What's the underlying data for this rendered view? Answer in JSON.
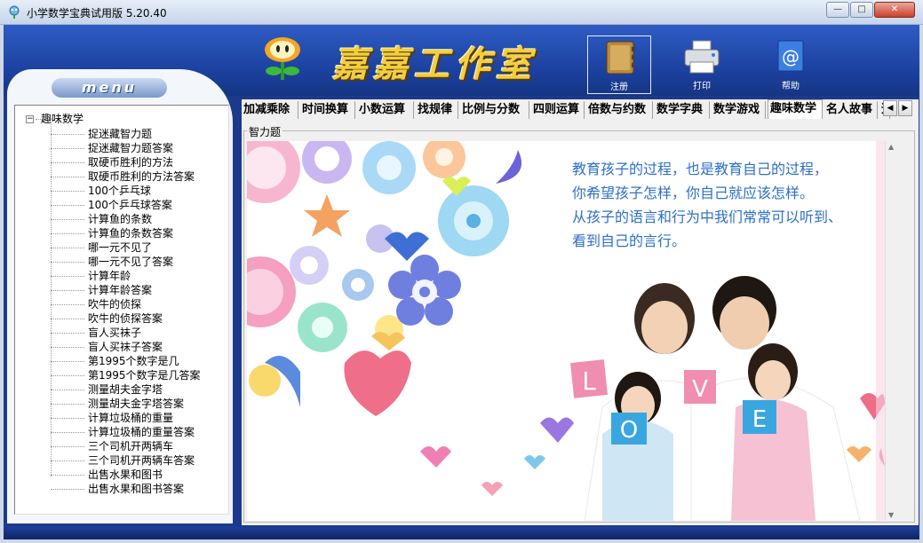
{
  "window": {
    "title": "小学数学宝典试用版  5.20.40",
    "min_glyph": "—",
    "max_glyph": "□",
    "close_glyph": "✕"
  },
  "banner": {
    "brand": "嘉嘉工作室",
    "tools": [
      {
        "label": "注册",
        "icon": "address-book-icon"
      },
      {
        "label": "打印",
        "icon": "printer-icon"
      },
      {
        "label": "帮助",
        "icon": "at-sign-help-icon"
      }
    ]
  },
  "menu": {
    "header": "menu",
    "root": "趣味数学",
    "items": [
      "捉迷藏智力题",
      "捉迷藏智力题答案",
      "取硬币胜利的方法",
      "取硬币胜利的方法答案",
      "100个乒乓球",
      "100个乒乓球答案",
      "计算鱼的条数",
      "计算鱼的条数答案",
      "哪一元不见了",
      "哪一元不见了答案",
      "计算年龄",
      "计算年龄答案",
      "吹牛的侦探",
      "吹牛的侦探答案",
      "盲人买袜子",
      "盲人买袜子答案",
      "第1995个数字是几",
      "第1995个数字是几答案",
      "测量胡夫金字塔",
      "测量胡夫金字塔答案",
      "计算垃圾桶的重量",
      "计算垃圾桶的重量答案",
      "三个司机开两辆车",
      "三个司机开两辆车答案",
      "出售水果和图书",
      "出售水果和图书答案"
    ]
  },
  "tabs": [
    {
      "label": "加减乘除"
    },
    {
      "label": "时间换算"
    },
    {
      "label": "小数运算"
    },
    {
      "label": "找规律"
    },
    {
      "label": "比例与分数"
    },
    {
      "label": "四则运算"
    },
    {
      "label": "倍数与约数"
    },
    {
      "label": "数学字典"
    },
    {
      "label": "数学游戏"
    },
    {
      "label": "趣味数学"
    },
    {
      "label": "名人故事"
    },
    {
      "label": "追"
    }
  ],
  "tab_scroll": {
    "left": "◀",
    "right": "▶"
  },
  "content": {
    "group_label": "智力题",
    "quote_lines": [
      "教育孩子的过程，也是教育自己的过程，",
      "你希望孩子怎样，你自己就应该怎样。",
      "从孩子的语言和行为中我们常常可以听到、",
      "看到自己的言行。"
    ],
    "cards": [
      "L",
      "O",
      "V",
      "E"
    ]
  },
  "colors": {
    "banner_blue": "#1a3f9c",
    "brand_gold": "#f3cf3c",
    "quote_blue": "#2d6fc9"
  }
}
